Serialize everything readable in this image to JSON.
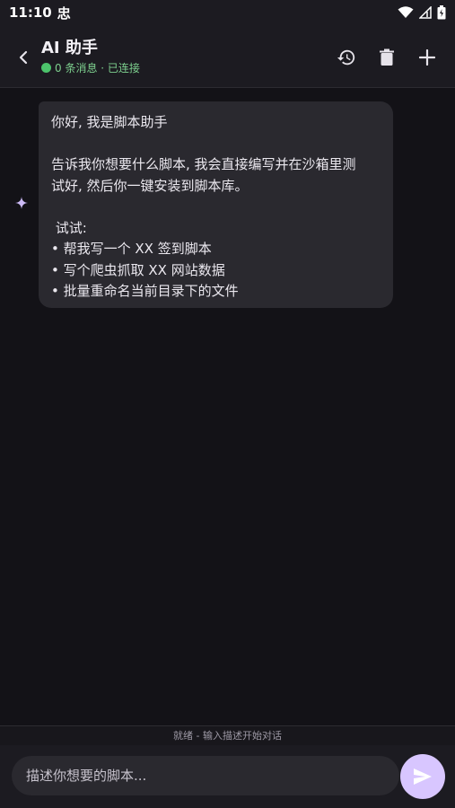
{
  "status_bar": {
    "time": "11:10",
    "notification_glyph": "忠"
  },
  "header": {
    "title": "AI 助手",
    "subtitle": "0 条消息 · 已连接",
    "status_color": "#4cc36b"
  },
  "icons": {
    "back": "chevron-left-icon",
    "history": "history-icon",
    "delete": "trash-icon",
    "add": "plus-icon",
    "assistant": "sparkle-icon",
    "send": "send-icon"
  },
  "message": {
    "greeting": "你好, 我是脚本助手",
    "intro_line1": "告诉我你想要什么脚本, 我会直接编写并在沙箱里测",
    "intro_line2": "试好, 然后你一键安装到脚本库。",
    "try_label": " 试试:",
    "examples": [
      "• 帮我写一个 XX 签到脚本",
      "• 写个爬虫抓取 XX 网站数据",
      "• 批量重命名当前目录下的文件"
    ]
  },
  "footer": {
    "status": "就绪 - 输入描述开始对话"
  },
  "input": {
    "placeholder": "描述你想要的脚本...",
    "value": ""
  },
  "colors": {
    "accent": "#d8c6ff",
    "background": "#131217",
    "bubble": "#2a292f"
  }
}
